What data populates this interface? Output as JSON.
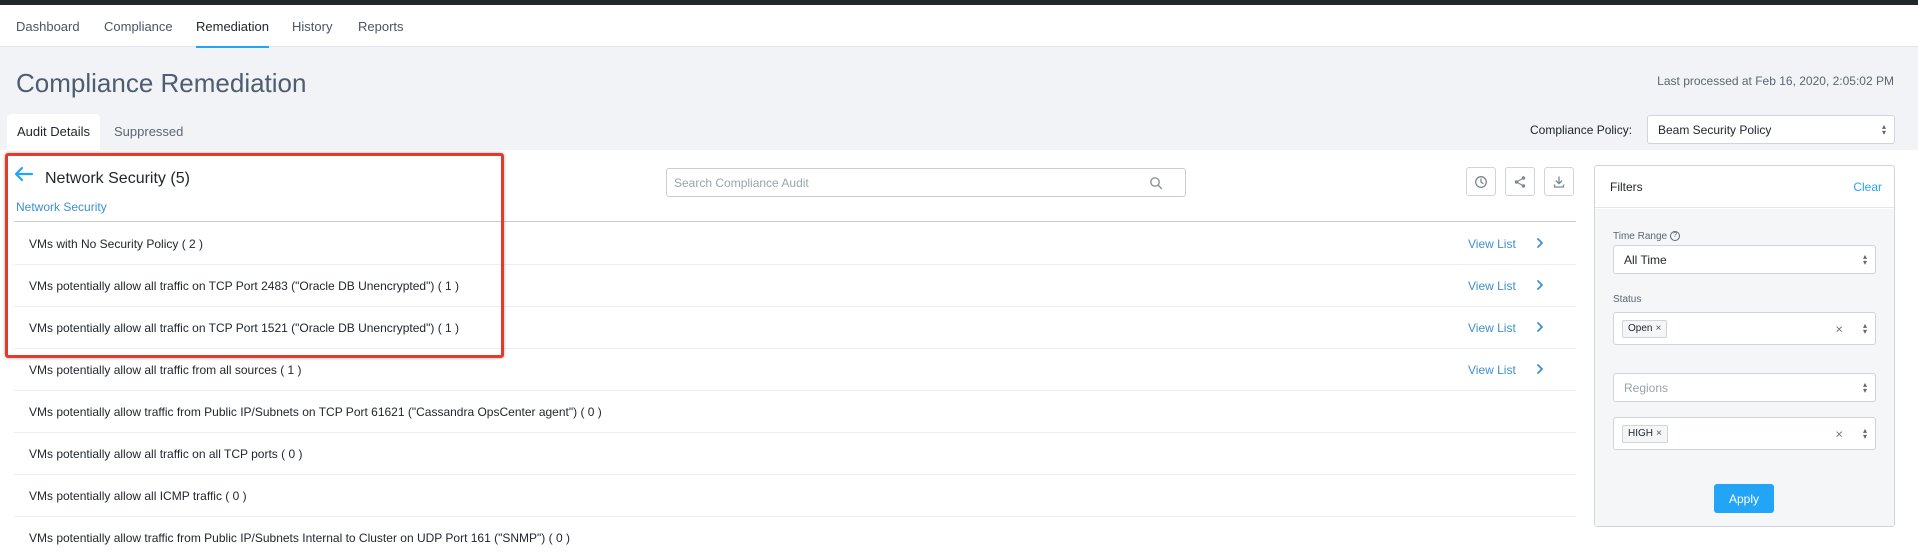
{
  "nav": {
    "items": [
      {
        "label": "Dashboard"
      },
      {
        "label": "Compliance"
      },
      {
        "label": "Remediation"
      },
      {
        "label": "History"
      },
      {
        "label": "Reports"
      }
    ],
    "active": "Remediation"
  },
  "header": {
    "title": "Compliance Remediation",
    "last_processed": "Last processed at Feb 16, 2020, 2:05:02 PM"
  },
  "tabs": [
    {
      "label": "Audit Details",
      "active": true
    },
    {
      "label": "Suppressed",
      "active": false
    }
  ],
  "policy": {
    "label": "Compliance Policy:",
    "value": "Beam Security Policy"
  },
  "section": {
    "title": "Network Security (5)",
    "subtitle": "Network Security"
  },
  "search": {
    "placeholder": "Search Compliance Audit"
  },
  "toolbar_icons": [
    "clock-icon",
    "share-icon",
    "download-icon"
  ],
  "audit_list": {
    "view_list_label": "View List",
    "items": [
      {
        "label": "VMs with No Security Policy ( 2 )",
        "has_view_list": true
      },
      {
        "label": "VMs potentially allow all traffic on TCP Port 2483 (\"Oracle DB Unencrypted\") ( 1 )",
        "has_view_list": true
      },
      {
        "label": "VMs potentially allow all traffic on TCP Port 1521 (\"Oracle DB Unencrypted\") ( 1 )",
        "has_view_list": true
      },
      {
        "label": "VMs potentially allow all traffic from all sources ( 1 )",
        "has_view_list": true
      },
      {
        "label": "VMs potentially allow traffic from Public IP/Subnets on TCP Port 61621 (\"Cassandra OpsCenter agent\") ( 0 )",
        "has_view_list": false
      },
      {
        "label": "VMs potentially allow all traffic on all TCP ports ( 0 )",
        "has_view_list": false
      },
      {
        "label": "VMs potentially allow all ICMP traffic ( 0 )",
        "has_view_list": false
      },
      {
        "label": "VMs potentially allow traffic from Public IP/Subnets Internal to Cluster on UDP Port 161 (\"SNMP\") ( 0 )",
        "has_view_list": false
      }
    ]
  },
  "filters": {
    "title": "Filters",
    "clear_label": "Clear",
    "time_range": {
      "label": "Time Range",
      "value": "All Time"
    },
    "status": {
      "label": "Status",
      "tags": [
        "Open"
      ]
    },
    "regions": {
      "placeholder": "Regions"
    },
    "severity": {
      "tags": [
        "HIGH"
      ]
    },
    "apply_label": "Apply"
  },
  "colors": {
    "accent": "#22a5f7",
    "link": "#3d8fd1",
    "highlight": "#e23b2e"
  }
}
